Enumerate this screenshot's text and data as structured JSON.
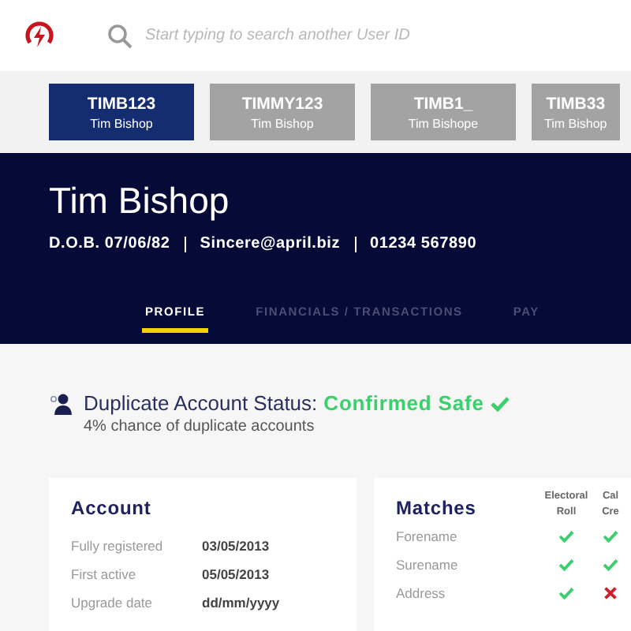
{
  "search": {
    "placeholder": "Start typing to search another User ID"
  },
  "users": [
    {
      "id": "TIMB123",
      "name": "Tim Bishop",
      "selected": true
    },
    {
      "id": "TIMMY123",
      "name": "Tim Bishop",
      "selected": false
    },
    {
      "id": "TIMB1_",
      "name": "Tim Bishope",
      "selected": false
    },
    {
      "id": "TIMB33",
      "name": "Tim Bishop",
      "selected": false
    }
  ],
  "profile": {
    "name": "Tim Bishop",
    "details": [
      "D.O.B. 07/06/82",
      "Sincere@april.biz",
      "01234 567890"
    ]
  },
  "tabs": [
    {
      "label": "PROFILE",
      "selected": true
    },
    {
      "label": "FINANCIALS / TRANSACTIONS",
      "selected": false
    },
    {
      "label": "PAY",
      "selected": false
    }
  ],
  "duplicate_status": {
    "label": "Duplicate Account Status:",
    "status": "Confirmed Safe",
    "safe": true,
    "note": "4% chance of duplicate accounts"
  },
  "account": {
    "title": "Account",
    "rows": [
      {
        "label": "Fully registered",
        "value": "03/05/2013"
      },
      {
        "label": "First active",
        "value": "05/05/2013"
      },
      {
        "label": "Upgrade date",
        "value": "dd/mm/yyyy"
      }
    ]
  },
  "matches": {
    "title": "Matches",
    "columns": [
      [
        "Electoral",
        "Roll"
      ],
      [
        "Cal",
        "Cre"
      ]
    ],
    "rows": [
      {
        "label": "Forename",
        "checks": [
          true,
          true
        ]
      },
      {
        "label": "Surename",
        "checks": [
          true,
          true
        ]
      },
      {
        "label": "Address",
        "checks": [
          true,
          false
        ]
      }
    ]
  }
}
